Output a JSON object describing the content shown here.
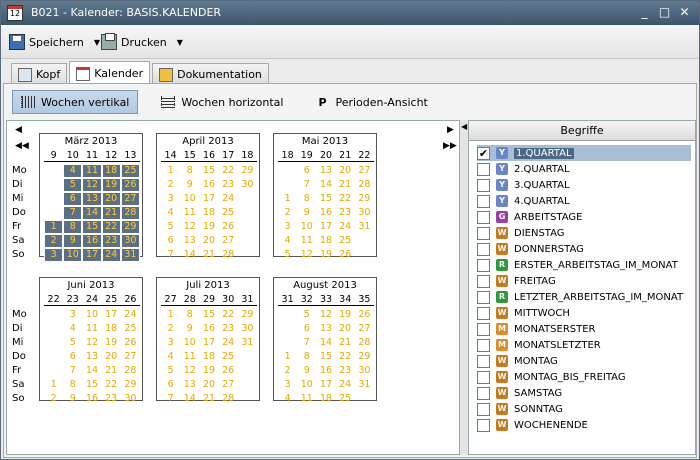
{
  "window": {
    "title": "B021 - Kalender: BASIS.KALENDER",
    "app_icon": "12"
  },
  "toolbar": {
    "save_label": "Speichern",
    "print_label": "Drucken"
  },
  "tabs": [
    {
      "label": "Kopf"
    },
    {
      "label": "Kalender"
    },
    {
      "label": "Dokumentation"
    }
  ],
  "views": [
    {
      "label": "Wochen vertikal"
    },
    {
      "label": "Wochen horizontal"
    },
    {
      "label": "Perioden-Ansicht"
    }
  ],
  "day_labels": [
    "Mo",
    "Di",
    "Mi",
    "Do",
    "Fr",
    "Sa",
    "So"
  ],
  "months": [
    {
      "title": "März 2013",
      "weeks": [
        "9",
        "10",
        "11",
        "12",
        "13"
      ],
      "rows": [
        [
          "",
          "4",
          "11",
          "18",
          "25"
        ],
        [
          "",
          "5",
          "12",
          "19",
          "26"
        ],
        [
          "",
          "6",
          "13",
          "20",
          "27"
        ],
        [
          "",
          "7",
          "14",
          "21",
          "28"
        ],
        [
          "1",
          "8",
          "15",
          "22",
          "29"
        ],
        [
          "2",
          "9",
          "16",
          "23",
          "30"
        ],
        [
          "3",
          "10",
          "17",
          "24",
          "31"
        ]
      ],
      "selected_from_col": 1,
      "selected_fri_from": 0
    },
    {
      "title": "April 2013",
      "weeks": [
        "14",
        "15",
        "16",
        "17",
        "18"
      ],
      "rows": [
        [
          "1",
          "8",
          "15",
          "22",
          "29"
        ],
        [
          "2",
          "9",
          "16",
          "23",
          "30"
        ],
        [
          "3",
          "10",
          "17",
          "24",
          ""
        ],
        [
          "4",
          "11",
          "18",
          "25",
          ""
        ],
        [
          "5",
          "12",
          "19",
          "26",
          ""
        ],
        [
          "6",
          "13",
          "20",
          "27",
          ""
        ],
        [
          "7",
          "14",
          "21",
          "28",
          ""
        ]
      ]
    },
    {
      "title": "Mai 2013",
      "weeks": [
        "18",
        "19",
        "20",
        "21",
        "22"
      ],
      "rows": [
        [
          "",
          "6",
          "13",
          "20",
          "27"
        ],
        [
          "",
          "7",
          "14",
          "21",
          "28"
        ],
        [
          "1",
          "8",
          "15",
          "22",
          "29"
        ],
        [
          "2",
          "9",
          "16",
          "23",
          "30"
        ],
        [
          "3",
          "10",
          "17",
          "24",
          "31"
        ],
        [
          "4",
          "11",
          "18",
          "25",
          ""
        ],
        [
          "5",
          "12",
          "19",
          "26",
          ""
        ]
      ]
    },
    {
      "title": "Juni 2013",
      "weeks": [
        "22",
        "23",
        "24",
        "25",
        "26"
      ],
      "rows": [
        [
          "",
          "3",
          "10",
          "17",
          "24"
        ],
        [
          "",
          "4",
          "11",
          "18",
          "25"
        ],
        [
          "",
          "5",
          "12",
          "19",
          "26"
        ],
        [
          "",
          "6",
          "13",
          "20",
          "27"
        ],
        [
          "",
          "7",
          "14",
          "21",
          "28"
        ],
        [
          "1",
          "8",
          "15",
          "22",
          "29"
        ],
        [
          "2",
          "9",
          "16",
          "23",
          "30"
        ]
      ]
    },
    {
      "title": "Juli 2013",
      "weeks": [
        "27",
        "28",
        "29",
        "30",
        "31"
      ],
      "rows": [
        [
          "1",
          "8",
          "15",
          "22",
          "29"
        ],
        [
          "2",
          "9",
          "16",
          "23",
          "30"
        ],
        [
          "3",
          "10",
          "17",
          "24",
          "31"
        ],
        [
          "4",
          "11",
          "18",
          "25",
          ""
        ],
        [
          "5",
          "12",
          "19",
          "26",
          ""
        ],
        [
          "6",
          "13",
          "20",
          "27",
          ""
        ],
        [
          "7",
          "14",
          "21",
          "28",
          ""
        ]
      ]
    },
    {
      "title": "August 2013",
      "weeks": [
        "31",
        "32",
        "33",
        "34",
        "35"
      ],
      "rows": [
        [
          "",
          "5",
          "12",
          "19",
          "26"
        ],
        [
          "",
          "6",
          "13",
          "20",
          "27"
        ],
        [
          "",
          "7",
          "14",
          "21",
          "28"
        ],
        [
          "1",
          "8",
          "15",
          "22",
          "29"
        ],
        [
          "2",
          "9",
          "16",
          "23",
          "30"
        ],
        [
          "3",
          "10",
          "17",
          "24",
          "31"
        ],
        [
          "4",
          "11",
          "18",
          "25",
          ""
        ]
      ]
    }
  ],
  "terms_header": "Begriffe",
  "terms": [
    {
      "label": "1.QUARTAL",
      "badge": "Y",
      "color": "#6a86c8",
      "checked": true,
      "selected": true
    },
    {
      "label": "2.QUARTAL",
      "badge": "Y",
      "color": "#6a86c8",
      "checked": false
    },
    {
      "label": "3.QUARTAL",
      "badge": "Y",
      "color": "#6a86c8",
      "checked": false
    },
    {
      "label": "4.QUARTAL",
      "badge": "Y",
      "color": "#6a86c8",
      "checked": false
    },
    {
      "label": "ARBEITSTAGE",
      "badge": "G",
      "color": "#9a3fa6",
      "checked": false
    },
    {
      "label": "DIENSTAG",
      "badge": "W",
      "color": "#c77a1c",
      "checked": false
    },
    {
      "label": "DONNERSTAG",
      "badge": "W",
      "color": "#c77a1c",
      "checked": false
    },
    {
      "label": "ERSTER_ARBEITSTAG_IM_MONAT",
      "badge": "R",
      "color": "#2f9a3a",
      "checked": false
    },
    {
      "label": "FREITAG",
      "badge": "W",
      "color": "#c77a1c",
      "checked": false
    },
    {
      "label": "LETZTER_ARBEITSTAG_IM_MONAT",
      "badge": "R",
      "color": "#2f9a3a",
      "checked": false
    },
    {
      "label": "MITTWOCH",
      "badge": "W",
      "color": "#c77a1c",
      "checked": false
    },
    {
      "label": "MONATSERSTER",
      "badge": "M",
      "color": "#e08a2a",
      "checked": false
    },
    {
      "label": "MONATSLETZTER",
      "badge": "M",
      "color": "#e08a2a",
      "checked": false
    },
    {
      "label": "MONTAG",
      "badge": "W",
      "color": "#c77a1c",
      "checked": false
    },
    {
      "label": "MONTAG_BIS_FREITAG",
      "badge": "W",
      "color": "#c77a1c",
      "checked": false
    },
    {
      "label": "SAMSTAG",
      "badge": "W",
      "color": "#c77a1c",
      "checked": false
    },
    {
      "label": "SONNTAG",
      "badge": "W",
      "color": "#c77a1c",
      "checked": false
    },
    {
      "label": "WOCHENENDE",
      "badge": "W",
      "color": "#c77a1c",
      "checked": false
    }
  ]
}
